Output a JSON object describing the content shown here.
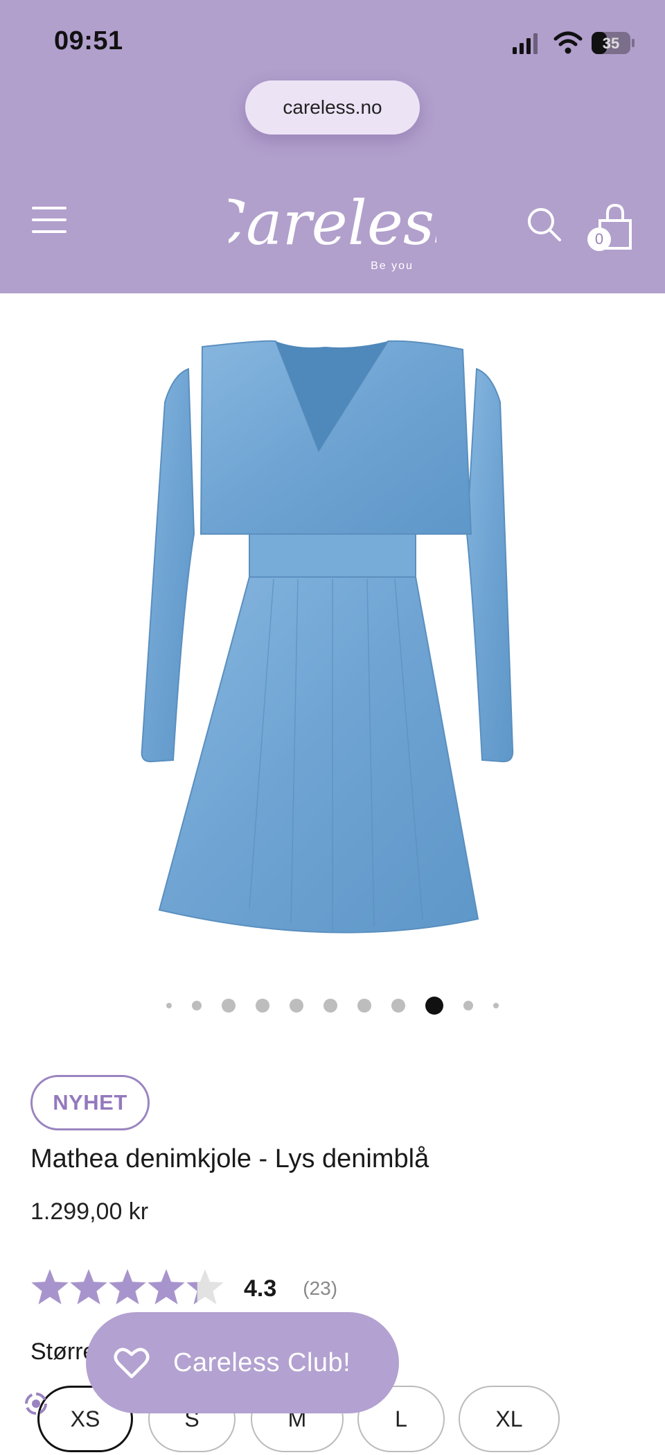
{
  "status_bar": {
    "time": "09:51",
    "battery": "35"
  },
  "browser": {
    "url": "careless.no"
  },
  "header": {
    "logo_text": "Careless",
    "logo_tagline": "Be you",
    "cart_count": "0",
    "icons": [
      "menu-icon",
      "search-icon",
      "shopping-bag-icon"
    ],
    "background_color": "#b19fcc"
  },
  "product": {
    "image_alt": "Light blue denim dress with V-neck and long puff sleeves",
    "carousel": {
      "total": 11,
      "active_index": 8
    },
    "badge": "NYHET",
    "title": "Mathea denimkjole - Lys denimblå",
    "price": "1.299,00 kr",
    "rating": {
      "stars": 4.3,
      "max": 5,
      "value_label": "4.3",
      "count_label": "(23)"
    },
    "size_label": "Størrelse",
    "sizes": [
      "XS",
      "S",
      "M",
      "L",
      "XL"
    ],
    "selected_size": "XS"
  },
  "club_button": {
    "label": "Careless Club!",
    "icon": "heart-icon",
    "color": "#b3a1d1"
  },
  "accessibility": {
    "icon": "accessibility-icon"
  }
}
